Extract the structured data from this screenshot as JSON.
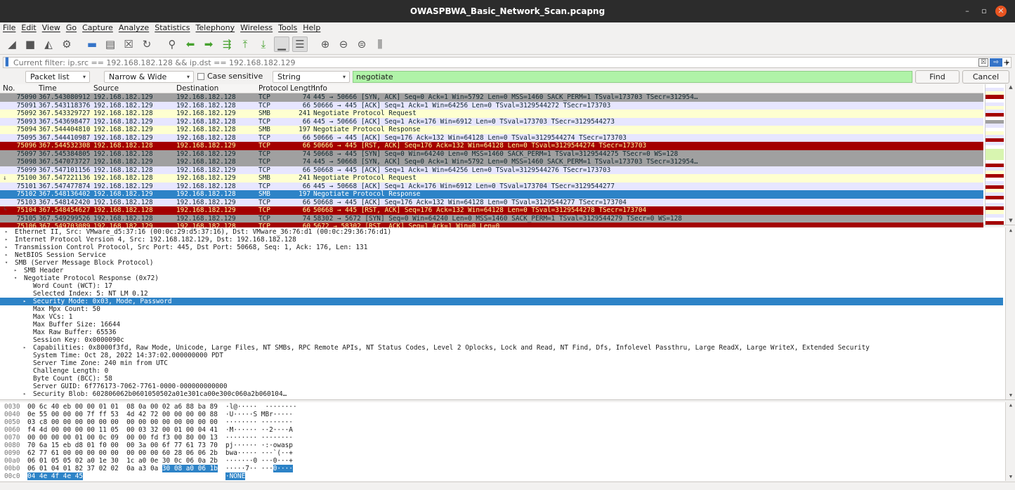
{
  "window": {
    "title": "OWASPBWA_Basic_Network_Scan.pcapng",
    "minimize": "–",
    "maximize": "▫",
    "close": "✕"
  },
  "menu": [
    "File",
    "Edit",
    "View",
    "Go",
    "Capture",
    "Analyze",
    "Statistics",
    "Telephony",
    "Wireless",
    "Tools",
    "Help"
  ],
  "toolbar_icons": [
    {
      "name": "start-capture-icon",
      "glyph": "◢",
      "style": ""
    },
    {
      "name": "stop-capture-icon",
      "glyph": "■",
      "style": ""
    },
    {
      "name": "restart-capture-icon",
      "glyph": "◭",
      "style": ""
    },
    {
      "name": "capture-options-icon",
      "glyph": "⚙",
      "style": ""
    },
    {
      "name": "sep",
      "glyph": "",
      "style": "sep"
    },
    {
      "name": "open-file-icon",
      "glyph": "▬",
      "style": "blue"
    },
    {
      "name": "save-file-icon",
      "glyph": "▤",
      "style": ""
    },
    {
      "name": "close-file-icon",
      "glyph": "☒",
      "style": ""
    },
    {
      "name": "reload-file-icon",
      "glyph": "↻",
      "style": ""
    },
    {
      "name": "sep",
      "glyph": "",
      "style": "sep"
    },
    {
      "name": "find-packet-icon",
      "glyph": "⚲",
      "style": ""
    },
    {
      "name": "go-back-icon",
      "glyph": "⬅",
      "style": "green"
    },
    {
      "name": "go-forward-icon",
      "glyph": "➡",
      "style": "green"
    },
    {
      "name": "go-to-packet-icon",
      "glyph": "⇶",
      "style": "green"
    },
    {
      "name": "first-packet-icon",
      "glyph": "⤒",
      "style": "green"
    },
    {
      "name": "last-packet-icon",
      "glyph": "⤓",
      "style": "green"
    },
    {
      "name": "auto-scroll-icon",
      "glyph": "▁",
      "style": "sel"
    },
    {
      "name": "colorize-icon",
      "glyph": "☰",
      "style": "sel"
    },
    {
      "name": "sep",
      "glyph": "",
      "style": "sep"
    },
    {
      "name": "zoom-in-icon",
      "glyph": "⊕",
      "style": ""
    },
    {
      "name": "zoom-out-icon",
      "glyph": "⊖",
      "style": ""
    },
    {
      "name": "normal-size-icon",
      "glyph": "⊜",
      "style": ""
    },
    {
      "name": "resize-columns-icon",
      "glyph": "⫼",
      "style": ""
    }
  ],
  "display_filter": {
    "placeholder": "Current filter: ip.src == 192.168.182.128 && ip.dst == 192.168.182.129",
    "value": "",
    "clear": "☒",
    "apply": "⇨",
    "dropdown": "▾",
    "add": "+"
  },
  "findbar": {
    "search_in": "Packet list",
    "char_width": "Narrow & Wide",
    "case_sensitive": "Case sensitive",
    "search_type": "String",
    "query": "negotiate",
    "find": "Find",
    "cancel": "Cancel",
    "arrow": "▾"
  },
  "packet_columns": [
    "No.",
    "Time",
    "Source",
    "Destination",
    "Protocol",
    "Length",
    "Info"
  ],
  "packets": [
    {
      "no": "75090",
      "time": "367.543080912",
      "src": "192.168.182.129",
      "dst": "192.168.182.128",
      "proto": "TCP",
      "len": "74",
      "info": "445 → 50666 [SYN, ACK] Seq=0 Ack=1 Win=5792 Len=0 MSS=1460 SACK_PERM=1 TSval=173703 TSecr=312954…",
      "bg": "#a0a0a0",
      "fg": "#12272e",
      "rel": ""
    },
    {
      "no": "75091",
      "time": "367.543118376",
      "src": "192.168.182.129",
      "dst": "192.168.182.128",
      "proto": "TCP",
      "len": "66",
      "info": "50666 → 445 [ACK] Seq=1 Ack=1 Win=64256 Len=0 TSval=3129544272 TSecr=173703",
      "bg": "#e7e6ff",
      "fg": "#12272e",
      "rel": ""
    },
    {
      "no": "75092",
      "time": "367.543329727",
      "src": "192.168.182.128",
      "dst": "192.168.182.129",
      "proto": "SMB",
      "len": "241",
      "info": "Negotiate Protocol Request",
      "bg": "#feffd0",
      "fg": "#12272e",
      "rel": ""
    },
    {
      "no": "75093",
      "time": "367.543698477",
      "src": "192.168.182.129",
      "dst": "192.168.182.128",
      "proto": "TCP",
      "len": "66",
      "info": "445 → 50666 [ACK] Seq=1 Ack=176 Win=6912 Len=0 TSval=173703 TSecr=3129544273",
      "bg": "#e7e6ff",
      "fg": "#12272e",
      "rel": ""
    },
    {
      "no": "75094",
      "time": "367.544404810",
      "src": "192.168.182.129",
      "dst": "192.168.182.128",
      "proto": "SMB",
      "len": "197",
      "info": "Negotiate Protocol Response",
      "bg": "#feffd0",
      "fg": "#12272e",
      "rel": ""
    },
    {
      "no": "75095",
      "time": "367.544410987",
      "src": "192.168.182.129",
      "dst": "192.168.182.128",
      "proto": "TCP",
      "len": "66",
      "info": "50666 → 445 [ACK] Seq=176 Ack=132 Win=64128 Len=0 TSval=3129544274 TSecr=173703",
      "bg": "#e7e6ff",
      "fg": "#12272e",
      "rel": ""
    },
    {
      "no": "75096",
      "time": "367.544532308",
      "src": "192.168.182.128",
      "dst": "192.168.182.129",
      "proto": "TCP",
      "len": "66",
      "info": "50666 → 445 [RST, ACK] Seq=176 Ack=132 Win=64128 Len=0 TSval=3129544274 TSecr=173703",
      "bg": "#a40000",
      "fg": "#fffc9c",
      "rel": ""
    },
    {
      "no": "75097",
      "time": "367.545384805",
      "src": "192.168.182.128",
      "dst": "192.168.182.129",
      "proto": "TCP",
      "len": "74",
      "info": "50668 → 445 [SYN] Seq=0 Win=64240 Len=0 MSS=1460 SACK_PERM=1 TSval=3129544275 TSecr=0 WS=128",
      "bg": "#a0a0a0",
      "fg": "#12272e",
      "rel": ""
    },
    {
      "no": "75098",
      "time": "367.547073727",
      "src": "192.168.182.129",
      "dst": "192.168.182.128",
      "proto": "TCP",
      "len": "74",
      "info": "445 → 50668 [SYN, ACK] Seq=0 Ack=1 Win=5792 Len=0 MSS=1460 SACK_PERM=1 TSval=173703 TSecr=312954…",
      "bg": "#a0a0a0",
      "fg": "#12272e",
      "rel": ""
    },
    {
      "no": "75099",
      "time": "367.547101156",
      "src": "192.168.182.128",
      "dst": "192.168.182.129",
      "proto": "TCP",
      "len": "66",
      "info": "50668 → 445 [ACK] Seq=1 Ack=1 Win=64256 Len=0 TSval=3129544276 TSecr=173703",
      "bg": "#e7e6ff",
      "fg": "#12272e",
      "rel": ""
    },
    {
      "no": "75100",
      "time": "367.547221136",
      "src": "192.168.182.128",
      "dst": "192.168.182.129",
      "proto": "SMB",
      "len": "241",
      "info": "Negotiate Protocol Request",
      "bg": "#feffd0",
      "fg": "#12272e",
      "rel": "↓"
    },
    {
      "no": "75101",
      "time": "367.547477874",
      "src": "192.168.182.129",
      "dst": "192.168.182.128",
      "proto": "TCP",
      "len": "66",
      "info": "445 → 50668 [ACK] Seq=1 Ack=176 Win=6912 Len=0 TSval=173704 TSecr=3129544277",
      "bg": "#e7e6ff",
      "fg": "#12272e",
      "rel": ""
    },
    {
      "no": "75102",
      "time": "367.548136402",
      "src": "192.168.182.129",
      "dst": "192.168.182.128",
      "proto": "SMB",
      "len": "197",
      "info": "Negotiate Protocol Response",
      "bg": "#2d83c7",
      "fg": "#ffffff",
      "rel": ""
    },
    {
      "no": "75103",
      "time": "367.548142420",
      "src": "192.168.182.128",
      "dst": "192.168.182.129",
      "proto": "TCP",
      "len": "66",
      "info": "50668 → 445 [ACK] Seq=176 Ack=132 Win=64128 Len=0 TSval=3129544277 TSecr=173704",
      "bg": "#e7e6ff",
      "fg": "#12272e",
      "rel": ""
    },
    {
      "no": "75104",
      "time": "367.548454627",
      "src": "192.168.182.128",
      "dst": "192.168.182.129",
      "proto": "TCP",
      "len": "66",
      "info": "50668 → 445 [RST, ACK] Seq=176 Ack=132 Win=64128 Len=0 TSval=3129544278 TSecr=173704",
      "bg": "#a40000",
      "fg": "#fffc9c",
      "rel": "└"
    },
    {
      "no": "75105",
      "time": "367.549299526",
      "src": "192.168.182.128",
      "dst": "192.168.182.129",
      "proto": "TCP",
      "len": "74",
      "info": "58302 → 5672 [SYN] Seq=0 Win=64240 Len=0 MSS=1460 SACK_PERM=1 TSval=3129544279 TSecr=0 WS=128",
      "bg": "#a0a0a0",
      "fg": "#12272e",
      "rel": ""
    },
    {
      "no": "75106",
      "time": "367.549703089",
      "src": "192.168.182.129",
      "dst": "192.168.182.128",
      "proto": "TCP",
      "len": "60",
      "info": "5672 → 58302 [RST, ACK] Seq=1 Ack=1 Win=0 Len=0",
      "bg": "#a40000",
      "fg": "#fffc9c",
      "rel": ""
    }
  ],
  "minimap_colors": [
    "#ffffff",
    "#e7e6ff",
    "#feffd0",
    "#a40000",
    "#ffffff",
    "#e7e6ff",
    "#feffd0",
    "#e7e6ff",
    "#a40000",
    "#ffffff",
    "#a0a0a0",
    "#e7e6ff",
    "#ffffff",
    "#feffd0",
    "#e7e6ff",
    "#a40000",
    "#e7e6ff",
    "#ffffff",
    "#d8f5b0",
    "#d8f5b0",
    "#d8f5b0",
    "#ffffff",
    "#a40000",
    "#e7e6ff",
    "#feffd0",
    "#a40000",
    "#ffffff",
    "#e7e6ff",
    "#a40000",
    "#feffd0",
    "#e7e6ff",
    "#a40000",
    "#ffffff",
    "#e7e6ff",
    "#a40000",
    "#feffd0",
    "#e7e6ff",
    "#ffffff",
    "#a40000"
  ],
  "details": [
    {
      "indent": 0,
      "exp": "▸",
      "text": "Ethernet II, Src: VMware_d5:37:16 (00:0c:29:d5:37:16), Dst: VMware_36:76:d1 (00:0c:29:36:76:d1)",
      "sel": false
    },
    {
      "indent": 0,
      "exp": "▸",
      "text": "Internet Protocol Version 4, Src: 192.168.182.129, Dst: 192.168.182.128",
      "sel": false
    },
    {
      "indent": 0,
      "exp": "▸",
      "text": "Transmission Control Protocol, Src Port: 445, Dst Port: 50668, Seq: 1, Ack: 176, Len: 131",
      "sel": false
    },
    {
      "indent": 0,
      "exp": "▸",
      "text": "NetBIOS Session Service",
      "sel": false
    },
    {
      "indent": 0,
      "exp": "▾",
      "text": "SMB (Server Message Block Protocol)",
      "sel": false
    },
    {
      "indent": 1,
      "exp": "▸",
      "text": "SMB Header",
      "sel": false
    },
    {
      "indent": 1,
      "exp": "▾",
      "text": "Negotiate Protocol Response (0x72)",
      "sel": false
    },
    {
      "indent": 2,
      "exp": "",
      "text": "Word Count (WCT): 17",
      "sel": false
    },
    {
      "indent": 2,
      "exp": "",
      "text": "Selected Index: 5: NT LM 0.12",
      "sel": false
    },
    {
      "indent": 2,
      "exp": "▸",
      "text": "Security Mode: 0x03, Mode, Password",
      "sel": true
    },
    {
      "indent": 2,
      "exp": "",
      "text": "Max Mpx Count: 50",
      "sel": false
    },
    {
      "indent": 2,
      "exp": "",
      "text": "Max VCs: 1",
      "sel": false
    },
    {
      "indent": 2,
      "exp": "",
      "text": "Max Buffer Size: 16644",
      "sel": false
    },
    {
      "indent": 2,
      "exp": "",
      "text": "Max Raw Buffer: 65536",
      "sel": false
    },
    {
      "indent": 2,
      "exp": "",
      "text": "Session Key: 0x0000090c",
      "sel": false
    },
    {
      "indent": 2,
      "exp": "▸",
      "text": "Capabilities: 0x8000f3fd, Raw Mode, Unicode, Large Files, NT SMBs, RPC Remote APIs, NT Status Codes, Level 2 Oplocks, Lock and Read, NT Find, Dfs, Infolevel Passthru, Large ReadX, Large WriteX, Extended Security",
      "sel": false
    },
    {
      "indent": 2,
      "exp": "",
      "text": "System Time: Oct 28, 2022 14:37:02.000000000 PDT",
      "sel": false
    },
    {
      "indent": 2,
      "exp": "",
      "text": "Server Time Zone: 240 min from UTC",
      "sel": false
    },
    {
      "indent": 2,
      "exp": "",
      "text": "Challenge Length: 0",
      "sel": false
    },
    {
      "indent": 2,
      "exp": "",
      "text": "Byte Count (BCC): 58",
      "sel": false
    },
    {
      "indent": 2,
      "exp": "",
      "text": "Server GUID: 6f776173-7062-7761-0000-000000000000",
      "sel": false
    },
    {
      "indent": 2,
      "exp": "▸",
      "text": "Security Blob: 602806062b0601050502a01e301ca00e300c060a2b060104…",
      "sel": false
    }
  ],
  "bytes": [
    {
      "off": "0030",
      "hex": "00 6c 40 eb 00 00 01 01  08 0a 00 02 a6 88 ba 89",
      "hex_hl": "",
      "asc": "·l@·····  ········",
      "asc_hl": ""
    },
    {
      "off": "0040",
      "hex": "0e 55 00 00 00 7f ff 53  4d 42 72 00 00 00 00 88",
      "hex_hl": "",
      "asc": "·U·····S MBr·····",
      "asc_hl": ""
    },
    {
      "off": "0050",
      "hex": "03 c8 00 00 00 00 00 00  00 00 00 00 00 00 00 00",
      "hex_hl": "",
      "asc": "········ ········",
      "asc_hl": ""
    },
    {
      "off": "0060",
      "hex": "f4 4d 00 00 00 00 11 05  00 03 32 00 01 00 04 41",
      "hex_hl": "",
      "asc": "·M······ ··2····A",
      "asc_hl": ""
    },
    {
      "off": "0070",
      "hex": "00 00 00 00 01 00 0c 09  00 00 fd f3 00 80 00 13",
      "hex_hl": "",
      "asc": "········ ········",
      "asc_hl": ""
    },
    {
      "off": "0080",
      "hex": "70 6a 15 eb d8 01 f0 00  00 3a 00 6f 77 61 73 70",
      "hex_hl": "",
      "asc": "pj······ ·:·owasp",
      "asc_hl": ""
    },
    {
      "off": "0090",
      "hex": "62 77 61 00 00 00 00 00  00 00 00 60 28 06 06 2b",
      "hex_hl": "",
      "asc": "bwa····· ···`(··+",
      "asc_hl": ""
    },
    {
      "off": "00a0",
      "hex": "06 01 05 05 02 a0 1e 30  1c a0 0e 30 0c 06 0a 2b",
      "hex_hl": "",
      "asc": "·······0 ···0···+",
      "asc_hl": ""
    },
    {
      "off": "00b0",
      "hex": "06 01 04 01 82 37 02 02  0a a3 0a ",
      "hex_hl": "30 08 a0 06 1b",
      "asc": "·····7·· ···",
      "asc_hl": "0····"
    },
    {
      "off": "00c0",
      "hex": "",
      "hex_hl": "04 4e 4f 4e 45",
      "asc": "",
      "asc_hl": "·NONE"
    }
  ],
  "colors": {
    "selected": "#2d83c7",
    "find_ok": "#b0f3a8",
    "titlebar": "#2c2c2c",
    "close": "#e95420"
  }
}
